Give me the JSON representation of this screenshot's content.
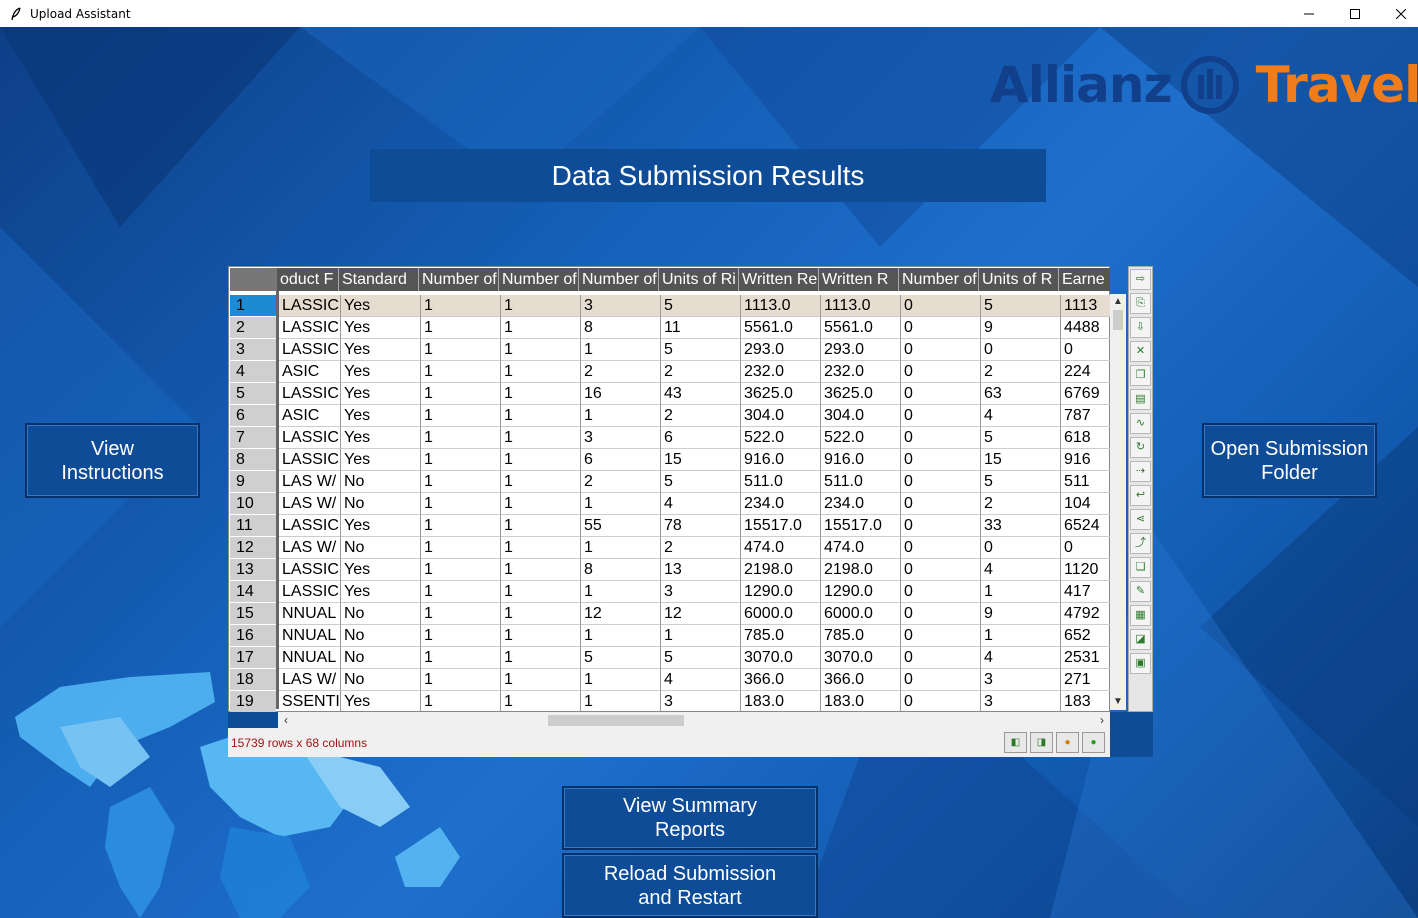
{
  "window": {
    "title": "Upload Assistant",
    "minimize": "—",
    "maximize": "☐",
    "close": "✕"
  },
  "logo": {
    "brand": "Allianz",
    "product": "Travel"
  },
  "header": {
    "title": "Data Submission Results"
  },
  "buttons": {
    "view_instructions": "View\nInstructions",
    "open_folder": "Open Submission\nFolder",
    "view_summary": "View Summary\nReports",
    "reload": "Reload Submission\nand Restart"
  },
  "table": {
    "columns": [
      "oduct F",
      "Standard",
      "Number of",
      "Number of",
      "Number of",
      "Units of Ri",
      "Written Re",
      "Written R",
      "Number of",
      "Units of R",
      "Earne"
    ],
    "row_numbers": [
      "1",
      "2",
      "3",
      "4",
      "5",
      "6",
      "7",
      "8",
      "9",
      "10",
      "11",
      "12",
      "13",
      "14",
      "15",
      "16",
      "17",
      "18",
      "19"
    ],
    "rows": [
      [
        "LASSIC",
        "Yes",
        "1",
        "1",
        "3",
        "5",
        "1113.0",
        "1113.0",
        "0",
        "5",
        "1113"
      ],
      [
        "LASSIC",
        "Yes",
        "1",
        "1",
        "8",
        "11",
        "5561.0",
        "5561.0",
        "0",
        "9",
        "4488"
      ],
      [
        "LASSIC",
        "Yes",
        "1",
        "1",
        "1",
        "5",
        "293.0",
        "293.0",
        "0",
        "0",
        "0"
      ],
      [
        "ASIC",
        "Yes",
        "1",
        "1",
        "2",
        "2",
        "232.0",
        "232.0",
        "0",
        "2",
        "224"
      ],
      [
        "LASSIC",
        "Yes",
        "1",
        "1",
        "16",
        "43",
        "3625.0",
        "3625.0",
        "0",
        "63",
        "6769"
      ],
      [
        "ASIC",
        "Yes",
        "1",
        "1",
        "1",
        "2",
        "304.0",
        "304.0",
        "0",
        "4",
        "787"
      ],
      [
        "LASSIC",
        "Yes",
        "1",
        "1",
        "3",
        "6",
        "522.0",
        "522.0",
        "0",
        "5",
        "618"
      ],
      [
        "LASSIC",
        "Yes",
        "1",
        "1",
        "6",
        "15",
        "916.0",
        "916.0",
        "0",
        "15",
        "916"
      ],
      [
        "LAS W/",
        "No",
        "1",
        "1",
        "2",
        "5",
        "511.0",
        "511.0",
        "0",
        "5",
        "511"
      ],
      [
        "LAS W/",
        "No",
        "1",
        "1",
        "1",
        "4",
        "234.0",
        "234.0",
        "0",
        "2",
        "104"
      ],
      [
        "LASSIC",
        "Yes",
        "1",
        "1",
        "55",
        "78",
        "15517.0",
        "15517.0",
        "0",
        "33",
        "6524"
      ],
      [
        "LAS W/",
        "No",
        "1",
        "1",
        "1",
        "2",
        "474.0",
        "474.0",
        "0",
        "0",
        "0"
      ],
      [
        "LASSIC",
        "Yes",
        "1",
        "1",
        "8",
        "13",
        "2198.0",
        "2198.0",
        "0",
        "4",
        "1120"
      ],
      [
        "LASSIC",
        "Yes",
        "1",
        "1",
        "1",
        "3",
        "1290.0",
        "1290.0",
        "0",
        "1",
        "417"
      ],
      [
        "NNUAL",
        "No",
        "1",
        "1",
        "12",
        "12",
        "6000.0",
        "6000.0",
        "0",
        "9",
        "4792"
      ],
      [
        "NNUAL",
        "No",
        "1",
        "1",
        "1",
        "1",
        "785.0",
        "785.0",
        "0",
        "1",
        "652"
      ],
      [
        "NNUAL",
        "No",
        "1",
        "1",
        "5",
        "5",
        "3070.0",
        "3070.0",
        "0",
        "4",
        "2531"
      ],
      [
        "LAS W/",
        "No",
        "1",
        "1",
        "1",
        "4",
        "366.0",
        "366.0",
        "0",
        "3",
        "271"
      ],
      [
        "SSENTI",
        "Yes",
        "1",
        "1",
        "1",
        "3",
        "183.0",
        "183.0",
        "0",
        "3",
        "183"
      ]
    ],
    "status": "15739 rows x 68 columns",
    "selected_row": 1
  },
  "toolbar_icons": [
    "export-icon",
    "save-icon",
    "import-icon",
    "excel-icon",
    "copy-icon",
    "paste-icon",
    "plot-icon",
    "refresh-icon",
    "redo-icon",
    "undo-icon",
    "share-icon",
    "chart-icon",
    "duplicate-icon",
    "edit-icon",
    "calculator-icon",
    "graph-icon",
    "report-icon"
  ],
  "nav_icons": [
    "prev-icon",
    "next-icon",
    "minus-icon",
    "plus-icon"
  ]
}
